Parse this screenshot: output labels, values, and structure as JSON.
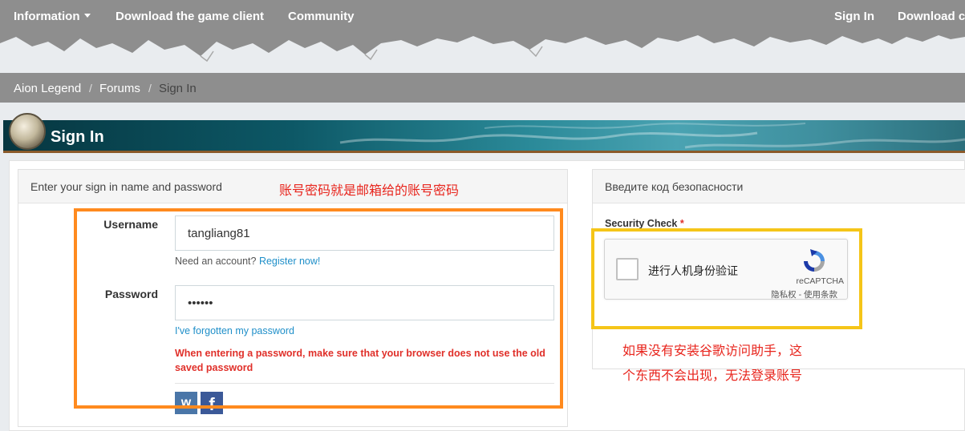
{
  "nav": {
    "information": "Information",
    "download": "Download the game client",
    "community": "Community",
    "sign_in": "Sign In",
    "download_right": "Download c"
  },
  "breadcrumb": {
    "home": "Aion Legend",
    "sep": "/",
    "forums": "Forums",
    "current": "Sign In"
  },
  "page": {
    "title": "Sign In"
  },
  "login_block": {
    "header": "Enter your sign in name and password",
    "annotation": "账号密码就是邮箱给的账号密码",
    "username_label": "Username",
    "username_value": "tangliang81",
    "need_account": "Need an account?",
    "register_link": "Register now!",
    "password_label": "Password",
    "password_value": "••••••",
    "forgot_link": "I've forgotten my password",
    "warning": "When entering a password, make sure that your browser does not use the old saved password",
    "social": {
      "vk": "vk-icon",
      "facebook": "facebook-icon"
    }
  },
  "security_block": {
    "header": "Введите код безопасности",
    "label": "Security Check",
    "required_mark": "*",
    "captcha_text": "进行人机身份验证",
    "captcha_brand": "reCAPTCHA",
    "captcha_privacy": "隐私权 - 使用条款",
    "annotation_line1": "如果没有安装谷歌访问助手，这",
    "annotation_line2": "个东西不会出现，无法登录账号"
  },
  "colors": {
    "nav_bg": "#8e8e8e",
    "highlight_orange": "#ff8a1e",
    "highlight_yellow": "#f5c518",
    "annotation_red": "#e8251d",
    "link_blue": "#1f8fc9"
  }
}
